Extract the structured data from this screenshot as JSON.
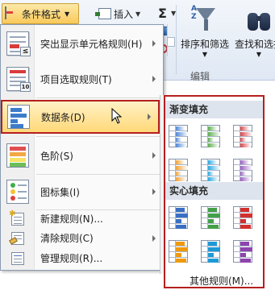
{
  "ribbon": {
    "conditional_format_label": "条件格式",
    "insert_label": "插入",
    "sigma_symbol": "Σ",
    "sort_filter_label": "排序和筛选",
    "find_select_label": "查找和选择",
    "group_label": "编辑",
    "az_text": "A\nZ"
  },
  "menu": {
    "items": [
      {
        "label": "突出显示单元格规则(H)",
        "icon": "highlight-cells-rules-icon",
        "submenu": true
      },
      {
        "label": "项目选取规则(T)",
        "icon": "top-bottom-rules-icon",
        "submenu": true,
        "badge": "10"
      },
      {
        "label": "数据条(D)",
        "icon": "data-bars-icon",
        "submenu": true,
        "highlighted": true
      },
      {
        "label": "色阶(S)",
        "icon": "color-scales-icon",
        "submenu": true
      },
      {
        "label": "图标集(I)",
        "icon": "icon-sets-icon",
        "submenu": true
      },
      {
        "label": "新建规则(N)...",
        "icon": "new-rule-icon"
      },
      {
        "label": "清除规则(C)",
        "icon": "clear-rules-icon",
        "submenu": true
      },
      {
        "label": "管理规则(R)...",
        "icon": "manage-rules-icon"
      }
    ]
  },
  "submenu": {
    "gradient_header": "渐变填充",
    "solid_header": "实心填充",
    "footer_label": "其他规则(M)...",
    "gradient_colors": [
      "#4f86d6",
      "#5fae4f",
      "#d9464a",
      "#f0a23a",
      "#2aa9e0",
      "#9a5fc1"
    ],
    "solid_colors": [
      "#3a6fc4",
      "#43a047",
      "#d32f2f",
      "#ef9a0f",
      "#1e9ad6",
      "#8e44ad"
    ]
  },
  "colors": {
    "highlight_border": "#b51f1f",
    "menu_highlight": "#ffd979",
    "ribbon_bg": "#dfe8f4"
  }
}
